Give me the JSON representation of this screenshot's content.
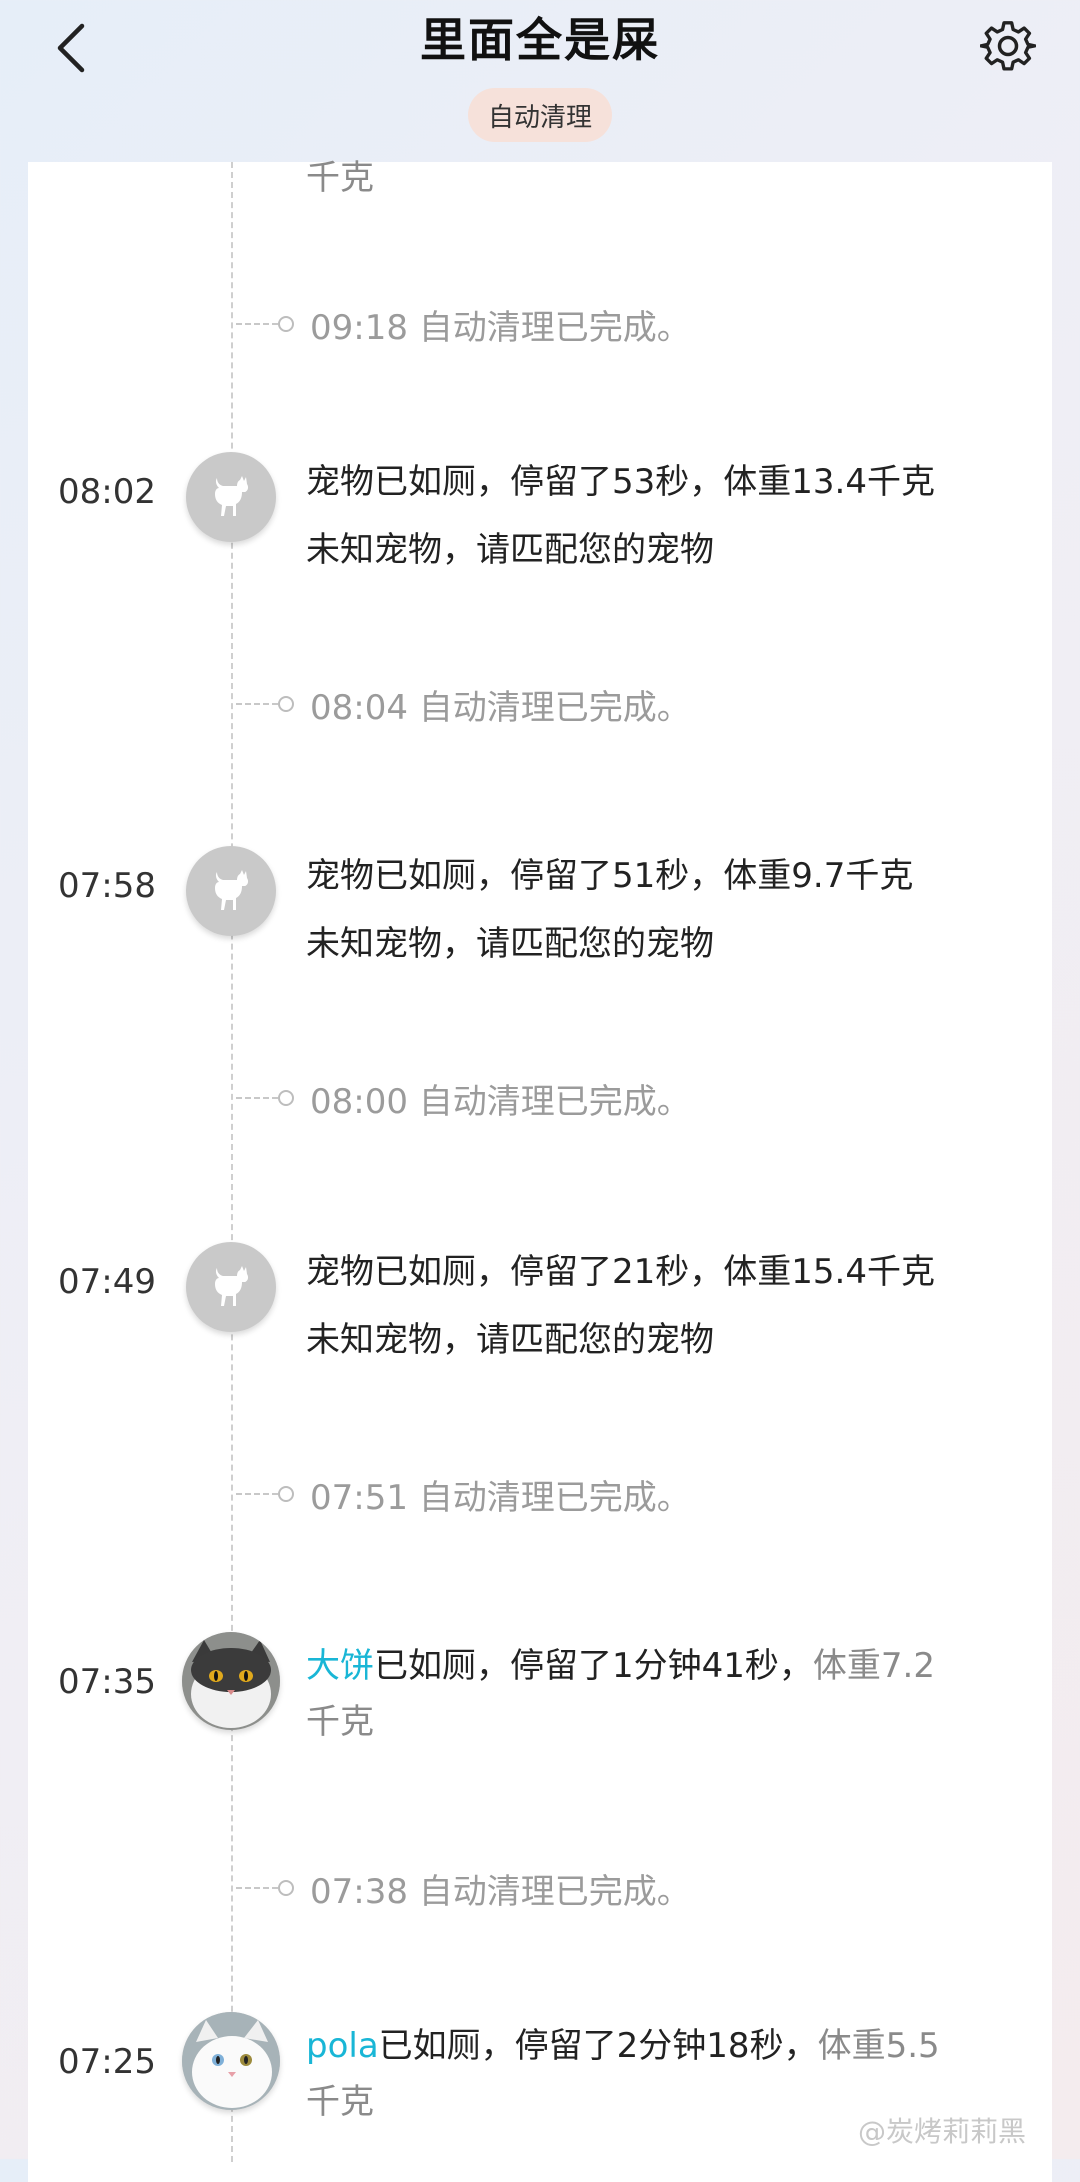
{
  "header": {
    "title": "里面全是屎",
    "chip_label": "自动清理"
  },
  "top_fragment": "千克",
  "entries": [
    {
      "type": "clean",
      "time": "09:18",
      "label": "自动清理已完成。"
    },
    {
      "type": "pet",
      "time": "08:02",
      "line1": "宠物已如厕，停留了53秒，体重13.4千克",
      "line2": "未知宠物，请匹配您的宠物"
    },
    {
      "type": "clean",
      "time": "08:04",
      "label": "自动清理已完成。"
    },
    {
      "type": "pet",
      "time": "07:58",
      "line1": "宠物已如厕，停留了51秒，体重9.7千克",
      "line2": "未知宠物，请匹配您的宠物"
    },
    {
      "type": "clean",
      "time": "08:00",
      "label": "自动清理已完成。"
    },
    {
      "type": "pet",
      "time": "07:49",
      "line1": "宠物已如厕，停留了21秒，体重15.4千克",
      "line2": "未知宠物，请匹配您的宠物"
    },
    {
      "type": "clean",
      "time": "07:51",
      "label": "自动清理已完成。"
    },
    {
      "type": "named",
      "time": "07:35",
      "name": "大饼",
      "mid": "已如厕，停留了1分钟41秒，",
      "weight": "体重7.2",
      "unit": "千克"
    },
    {
      "type": "clean",
      "time": "07:38",
      "label": "自动清理已完成。"
    },
    {
      "type": "named",
      "time": "07:25",
      "name": "pola",
      "mid": "已如厕，停留了2分钟18秒，",
      "weight": "体重5.5",
      "unit": "千克"
    }
  ],
  "watermark": "@炭烤莉莉黑",
  "colors": {
    "name_accent": "#19b6d6",
    "chip_bg": "#f6e1da"
  },
  "icons": {
    "back": "chevron-left-icon",
    "settings": "gear-icon",
    "pet": "cat-icon"
  }
}
